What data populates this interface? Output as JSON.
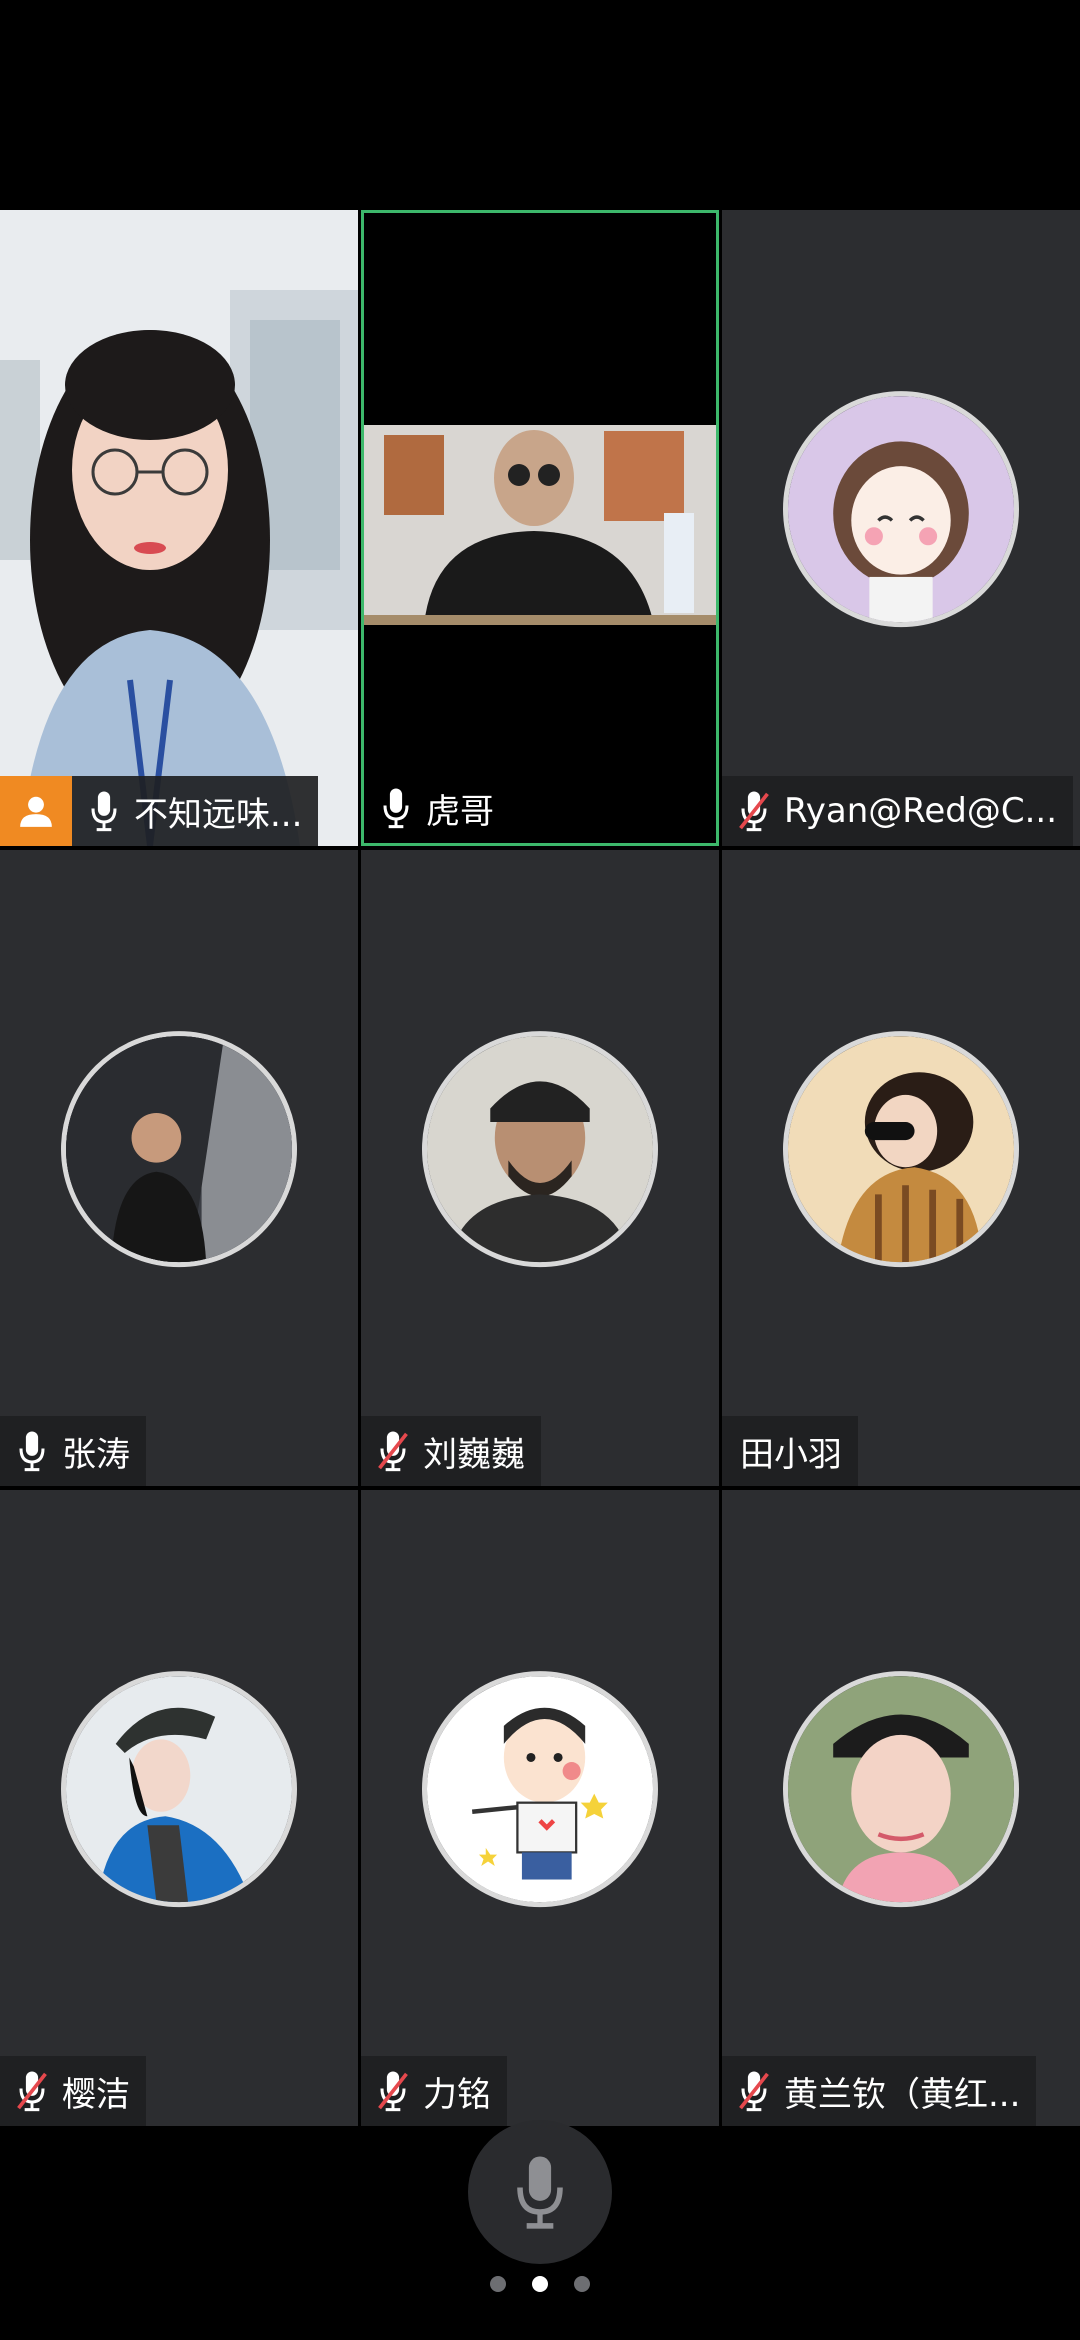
{
  "participants": [
    {
      "name": "不知远味...",
      "mic": "on",
      "host": true,
      "video": true
    },
    {
      "name": "虎哥",
      "mic": "on",
      "host": false,
      "video": true,
      "active": true
    },
    {
      "name": "Ryan@Red@C...",
      "mic": "muted",
      "host": false,
      "video": false
    },
    {
      "name": "张涛",
      "mic": "on",
      "host": false,
      "video": false
    },
    {
      "name": "刘巍巍",
      "mic": "muted",
      "host": false,
      "video": false
    },
    {
      "name": "田小羽",
      "mic": "none",
      "host": false,
      "video": false
    },
    {
      "name": "樱洁",
      "mic": "muted",
      "host": false,
      "video": false
    },
    {
      "name": "力铭",
      "mic": "muted",
      "host": false,
      "video": false
    },
    {
      "name": "黄兰钦（黄红...",
      "mic": "muted",
      "host": false,
      "video": false
    }
  ],
  "pager": {
    "pages": 3,
    "current": 2
  },
  "colors": {
    "tile_bg": "#2c2d30",
    "active_border": "#3db86b",
    "host_badge": "#f08a22",
    "muted_slash": "#e5484d"
  }
}
